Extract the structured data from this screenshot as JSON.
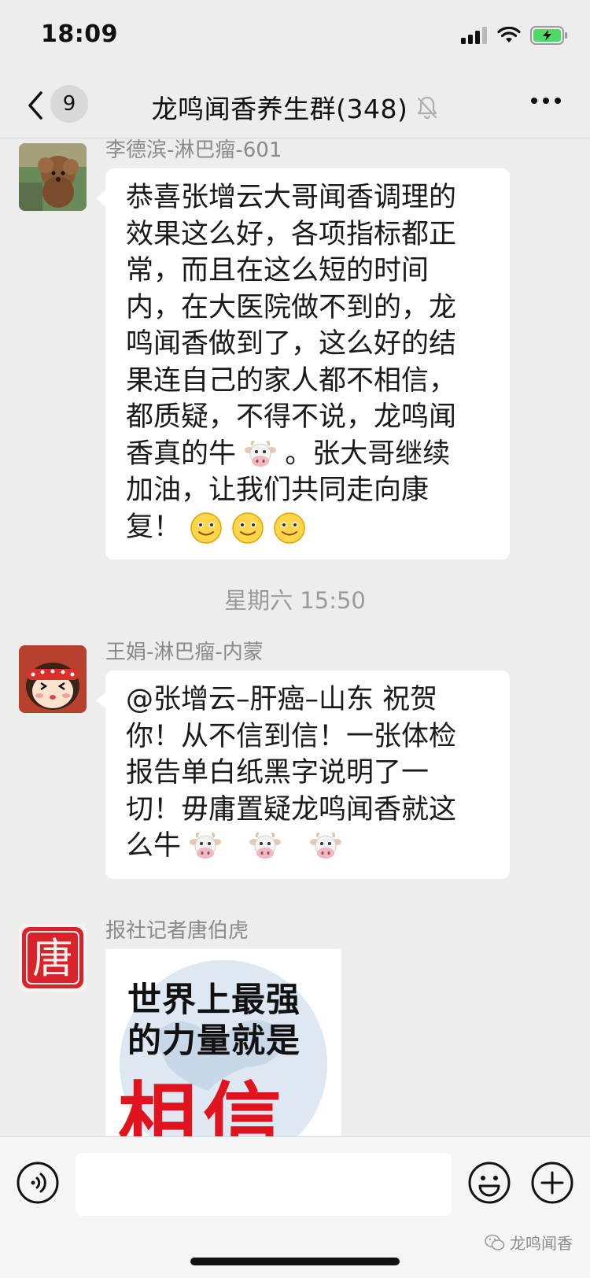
{
  "status_bar": {
    "time": "18:09"
  },
  "nav": {
    "unread_count": "9",
    "title": "龙鸣闻香养生群(348)"
  },
  "messages": [
    {
      "sender": "李德滨-淋巴瘤-601",
      "lines": [
        "恭喜张增云大哥闻香调理的",
        "效果这么好，各项指标都正",
        "常，而且在这么短的时间",
        "内，在大医院做不到的，龙",
        "鸣闻香做到了，这么好的结",
        "果连自己的家人都不相信，",
        "都质疑，不得不说，龙鸣闻"
      ],
      "line8": "香真的牛",
      "line8_end": "。张大哥继续",
      "line9": "加油，让我们共同走向康",
      "line10": "复！"
    },
    {
      "sender": "王娟-淋巴瘤-内蒙",
      "lines": [
        "@张增云–肝癌–山东 祝贺",
        "你！从不信到信！一张体检",
        "报告单白纸黑字说明了一",
        "切！毋庸置疑龙鸣闻香就这"
      ],
      "last": "么牛"
    },
    {
      "sender": "报社记者唐伯虎",
      "card_line1": "世界上最强",
      "card_line2": "的力量就是",
      "card_big": "相信",
      "seal_char": "唐"
    }
  ],
  "timestamp": "星期六 15:50",
  "watermark": "龙鸣闻香",
  "colors": {
    "background": "#ededed",
    "bubble": "#ffffff",
    "accent_red": "#e0141e",
    "battery_green": "#4cd964"
  },
  "icons": [
    "back-icon",
    "mute-bell-icon",
    "more-icon",
    "voice-icon",
    "emoji-icon",
    "plus-icon",
    "signal-icon",
    "wifi-icon",
    "battery-icon",
    "cow-emoji",
    "smile-emoji"
  ]
}
